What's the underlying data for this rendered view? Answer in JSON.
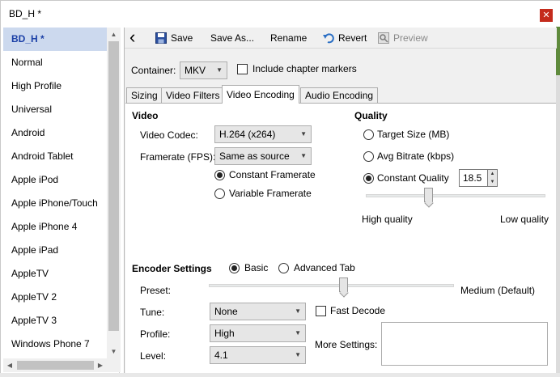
{
  "window": {
    "title": "BD_H *",
    "close_glyph": "✕"
  },
  "sidebar": {
    "items": [
      "BD_H *",
      "Normal",
      "High Profile",
      "Universal",
      "Android",
      "Android Tablet",
      "Apple iPod",
      "Apple iPhone/Touch",
      "Apple iPhone 4",
      "Apple iPad",
      "AppleTV",
      "AppleTV 2",
      "AppleTV 3",
      "Windows Phone 7"
    ],
    "selected_index": 0
  },
  "toolbar": {
    "back_icon": "‹",
    "save": "Save",
    "save_as": "Save As...",
    "rename": "Rename",
    "revert": "Revert",
    "preview": "Preview"
  },
  "container": {
    "label": "Container:",
    "value": "MKV",
    "chapter_label": "Include chapter markers"
  },
  "tabs": [
    "Sizing",
    "Video Filters",
    "Video Encoding",
    "Audio Encoding"
  ],
  "video": {
    "heading": "Video",
    "codec_label": "Video Codec:",
    "codec_value": "H.264 (x264)",
    "fps_label": "Framerate (FPS):",
    "fps_value": "Same as source",
    "constant_framerate": "Constant Framerate",
    "variable_framerate": "Variable Framerate"
  },
  "quality": {
    "heading": "Quality",
    "target_size": "Target Size (MB)",
    "avg_bitrate": "Avg Bitrate (kbps)",
    "constant_quality": "Constant Quality",
    "cq_value": "18.5",
    "high_label": "High quality",
    "low_label": "Low quality",
    "slider_fraction": 0.35
  },
  "encoder": {
    "heading": "Encoder Settings",
    "basic": "Basic",
    "advanced": "Advanced Tab",
    "preset_label": "Preset:",
    "preset_value": "Medium (Default)",
    "preset_fraction": 0.55,
    "tune_label": "Tune:",
    "tune_value": "None",
    "fast_decode": "Fast Decode",
    "profile_label": "Profile:",
    "profile_value": "High",
    "level_label": "Level:",
    "level_value": "4.1",
    "more_settings": "More Settings:"
  }
}
